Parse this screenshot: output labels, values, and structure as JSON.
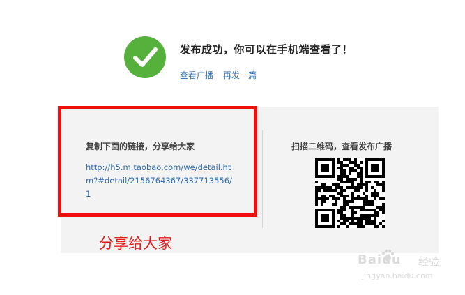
{
  "header": {
    "title": "发布成功，你可以在手机端查看了！",
    "links": {
      "view": "查看广播",
      "repost": "再发一篇"
    }
  },
  "share": {
    "label": "复制下面的链接，分享给大家",
    "url": "http://h5.m.taobao.com/we/detail.htm?#detail/2156764367/337713556/1"
  },
  "qr": {
    "label": "扫描二维码，查看发布广播"
  },
  "annotation": {
    "text": "分享给大家"
  },
  "watermark": {
    "brand": "Baidu",
    "brand_suffix": "经验",
    "url": "jingyan.baidu.com"
  },
  "colors": {
    "success_green": "#56b13c",
    "link_blue": "#2b6db5",
    "annotation_red": "#ee0f0f",
    "panel_bg": "#f3f3f3"
  },
  "icons": [
    "checkmark-icon",
    "qr-code",
    "baidu-paw-icon"
  ]
}
